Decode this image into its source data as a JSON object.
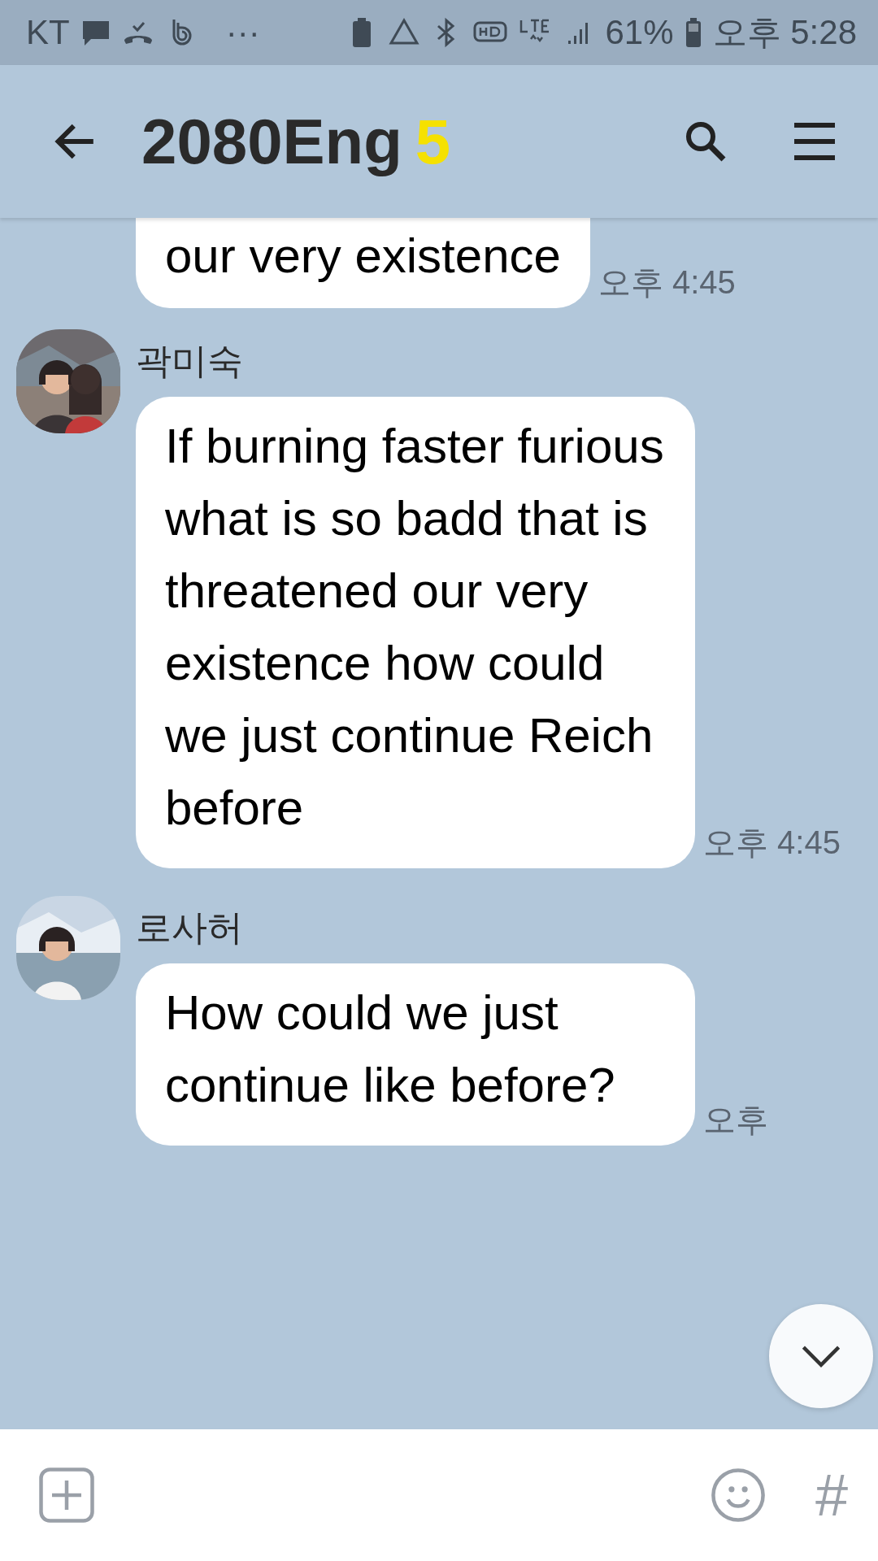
{
  "status_bar": {
    "carrier": "KT",
    "more": "···",
    "battery_percent": "61%",
    "time": "오후 5:28"
  },
  "header": {
    "title": "2080Eng",
    "member_count": "5"
  },
  "messages": [
    {
      "kind": "continuation",
      "text": "our very existence",
      "time": "오후 4:45"
    },
    {
      "kind": "with_sender",
      "sender": "곽미숙",
      "text": "If burning faster furious what is so badd that is threatened our very existence how could we just continue Reich before",
      "time": "오후 4:45"
    },
    {
      "kind": "with_sender",
      "sender": "로사허",
      "text": "How could we just continue like before?",
      "time": "오후"
    }
  ],
  "input_bar": {
    "hashtag": "#"
  }
}
